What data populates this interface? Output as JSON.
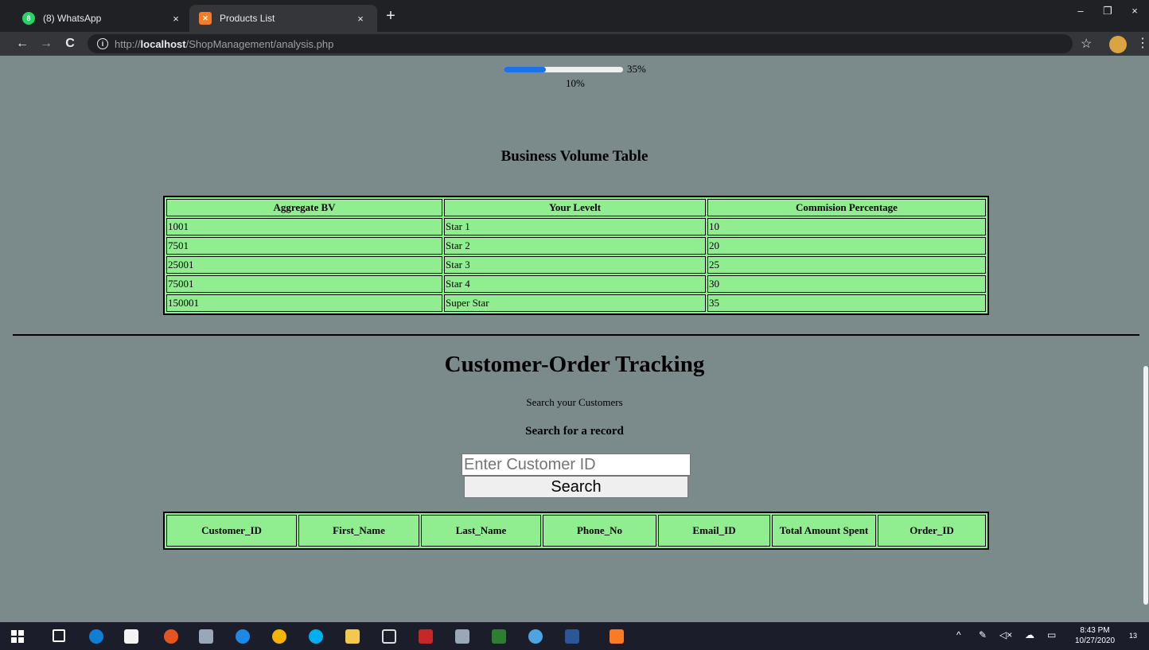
{
  "browser": {
    "tabs": [
      {
        "title": "(8) WhatsApp",
        "badge": "8",
        "active": false
      },
      {
        "title": "Products List",
        "active": true
      }
    ],
    "new_tab_label": "+",
    "close_label": "×",
    "window_controls": {
      "minimize": "–",
      "maximize": "❐",
      "close": "×"
    },
    "nav": {
      "back": "←",
      "forward": "→",
      "reload": "C"
    },
    "url": {
      "scheme": "http://",
      "host": "localhost",
      "path": "/ShopManagement/analysis.php"
    },
    "info_glyph": "i",
    "star_glyph": "☆",
    "menu_glyph": "⋮"
  },
  "progress": {
    "value": 0.35,
    "label": "35%",
    "secondary_label": "10%",
    "fill_color": "#1a73e8"
  },
  "bv_table": {
    "title": "Business Volume Table",
    "headers": [
      "Aggregate BV",
      "Your Levelt",
      "Commision Percentage"
    ],
    "rows": [
      [
        "1001",
        "Star 1",
        "10"
      ],
      [
        "7501",
        "Star 2",
        "20"
      ],
      [
        "25001",
        "Star 3",
        "25"
      ],
      [
        "75001",
        "Star 4",
        "30"
      ],
      [
        "150001",
        "Super Star",
        "35"
      ]
    ]
  },
  "tracking": {
    "title": "Customer-Order Tracking",
    "subtitle": "Search your Customers",
    "search_heading": "Search for a record",
    "search_placeholder": "Enter Customer ID",
    "search_button": "Search",
    "headers": [
      "Customer_ID",
      "First_Name",
      "Last_Name",
      "Phone_No",
      "Email_ID",
      "Total Amount Spent",
      "Order_ID"
    ]
  },
  "taskbar": {
    "time": "8:43 PM",
    "date": "10/27/2020",
    "notification_count": "13"
  },
  "colors": {
    "page_bg": "#7b8a8b",
    "table_bg": "#90ee90",
    "chrome_dark": "#202124"
  }
}
